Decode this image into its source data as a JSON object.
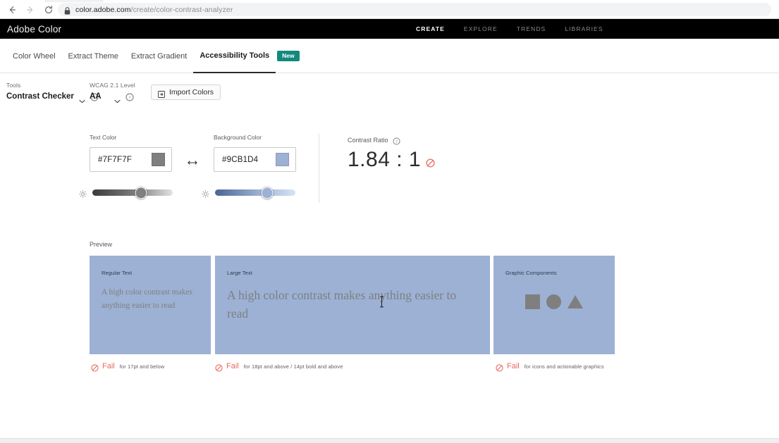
{
  "browser": {
    "url_host": "color.adobe.com",
    "url_path": "/create/color-contrast-analyzer",
    "back_icon": "arrow-left-icon",
    "forward_icon": "arrow-right-icon",
    "reload_icon": "reload-icon",
    "lock_icon": "lock-icon"
  },
  "header": {
    "brand": "Adobe Color",
    "nav": [
      {
        "label": "CREATE",
        "active": true
      },
      {
        "label": "EXPLORE",
        "active": false
      },
      {
        "label": "TRENDS",
        "active": false
      },
      {
        "label": "LIBRARIES",
        "active": false
      }
    ]
  },
  "subtabs": [
    {
      "label": "Color Wheel",
      "active": false
    },
    {
      "label": "Extract Theme",
      "active": false
    },
    {
      "label": "Extract Gradient",
      "active": false
    },
    {
      "label": "Accessibility Tools",
      "active": true,
      "badge": "New"
    }
  ],
  "toolbar": {
    "tools_label": "Tools",
    "tools_value": "Contrast Checker",
    "wcag_label": "WCAG 2.1 Level",
    "wcag_value": "AA",
    "import_label": "Import Colors",
    "import_icon": "import-icon",
    "help_icon": "help-circle-icon",
    "chevron_icon": "chevron-down-icon"
  },
  "colors": {
    "text": {
      "label": "Text Color",
      "hex": "#7F7F7F",
      "swatch": "#7F7F7F",
      "slider_icon": "brightness-icon"
    },
    "background": {
      "label": "Background Color",
      "hex": "#9CB1D4",
      "swatch": "#9CB1D4",
      "slider_icon": "brightness-icon"
    },
    "swap_icon": "swap-horizontal-icon"
  },
  "contrast": {
    "label": "Contrast Ratio",
    "value": "1.84 : 1",
    "status_icon": "fail-prohibited-icon",
    "help_icon": "help-circle-icon"
  },
  "preview": {
    "title": "Preview",
    "cards": [
      {
        "caption": "Regular Text",
        "body": "A high color contrast makes anything easier to read",
        "kind": "text"
      },
      {
        "caption": "Large Text",
        "body": "A high color contrast makes anything easier to read",
        "kind": "text"
      },
      {
        "caption": "Graphic Components",
        "body": "",
        "kind": "graphic",
        "shapes": [
          "square-shape",
          "circle-shape",
          "triangle-shape"
        ]
      }
    ]
  },
  "results": [
    {
      "status": "Fail",
      "note": "for 17pt and below",
      "icon": "fail-prohibited-icon"
    },
    {
      "status": "Fail",
      "note": "for 18pt and above / 14pt bold and above",
      "icon": "fail-prohibited-icon"
    },
    {
      "status": "Fail",
      "note": "for icons and actionable graphics",
      "icon": "fail-prohibited-icon"
    }
  ],
  "palette": {
    "brand_black": "#000000",
    "badge_teal": "#13897E",
    "fail_red": "#E8685B",
    "text_color": "#7F7F7F",
    "background_color": "#9CB1D4"
  }
}
